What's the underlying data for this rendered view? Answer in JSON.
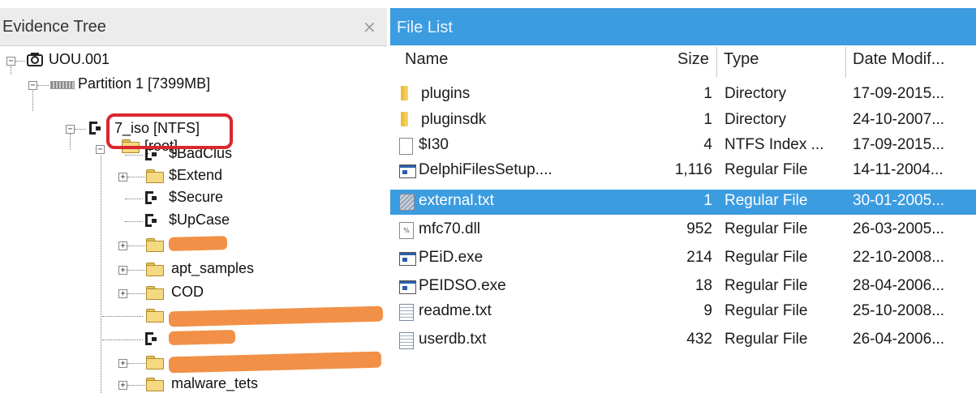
{
  "tree_panel": {
    "title": "Evidence Tree",
    "close_glyph": "×",
    "nodes": [
      {
        "label": "UOU.001",
        "icon": "evidence-drive-icon"
      },
      {
        "label": "Partition 1 [7399MB]",
        "icon": "partition-icon"
      },
      {
        "label": "7_iso [NTFS]",
        "icon": "ntfs-volume-icon"
      },
      {
        "label": "[root]",
        "icon": "folder-icon"
      },
      {
        "label": "$BadClus",
        "icon": "ntfs-file-icon"
      },
      {
        "label": "$Extend",
        "icon": "folder-icon"
      },
      {
        "label": "$Secure",
        "icon": "ntfs-file-icon"
      },
      {
        "label": "$UpCase",
        "icon": "ntfs-file-icon"
      },
      {
        "label": "",
        "icon": "folder-icon",
        "redacted": true
      },
      {
        "label": "apt_samples",
        "icon": "folder-icon"
      },
      {
        "label": "COD",
        "icon": "folder-icon"
      },
      {
        "label": "",
        "icon": "folder-icon",
        "redacted": true
      },
      {
        "label": "",
        "icon": "ntfs-file-icon",
        "redacted": true
      },
      {
        "label": "",
        "icon": "folder-icon",
        "redacted": true
      },
      {
        "label": "malware_tets",
        "icon": "folder-icon"
      }
    ]
  },
  "file_panel": {
    "title": "File List",
    "columns": {
      "name": "Name",
      "size": "Size",
      "type": "Type",
      "date": "Date Modif..."
    },
    "files": [
      {
        "name": "plugins",
        "size": "1",
        "type": "Directory",
        "date": "17-09-2015...",
        "icon": "folder-icon"
      },
      {
        "name": "pluginsdk",
        "size": "1",
        "type": "Directory",
        "date": "24-10-2007...",
        "icon": "folder-icon"
      },
      {
        "name": "$I30",
        "size": "4",
        "type": "NTFS Index ...",
        "date": "17-09-2015...",
        "icon": "blank-page-icon"
      },
      {
        "name": "DelphiFilesSetup....",
        "size": "1,116",
        "type": "Regular File",
        "date": "14-11-2004...",
        "icon": "executable-icon"
      },
      {
        "name": "external.txt",
        "size": "1",
        "type": "Regular File",
        "date": "30-01-2005...",
        "icon": "text-file-icon",
        "selected": true
      },
      {
        "name": "mfc70.dll",
        "size": "952",
        "type": "Regular File",
        "date": "26-03-2005...",
        "icon": "dll-file-icon"
      },
      {
        "name": "PEiD.exe",
        "size": "214",
        "type": "Regular File",
        "date": "22-10-2008...",
        "icon": "executable-icon"
      },
      {
        "name": "PEIDSO.exe",
        "size": "18",
        "type": "Regular File",
        "date": "28-04-2006...",
        "icon": "executable-icon"
      },
      {
        "name": "readme.txt",
        "size": "9",
        "type": "Regular File",
        "date": "25-10-2008...",
        "icon": "text-file-icon"
      },
      {
        "name": "userdb.txt",
        "size": "432",
        "type": "Regular File",
        "date": "26-04-2006...",
        "icon": "text-file-icon"
      }
    ]
  },
  "colors": {
    "selection": "#3c9ce0",
    "header_blue": "#3c9ce0",
    "annotation_red": "#d9272e",
    "redaction_orange": "#f08a3c"
  }
}
